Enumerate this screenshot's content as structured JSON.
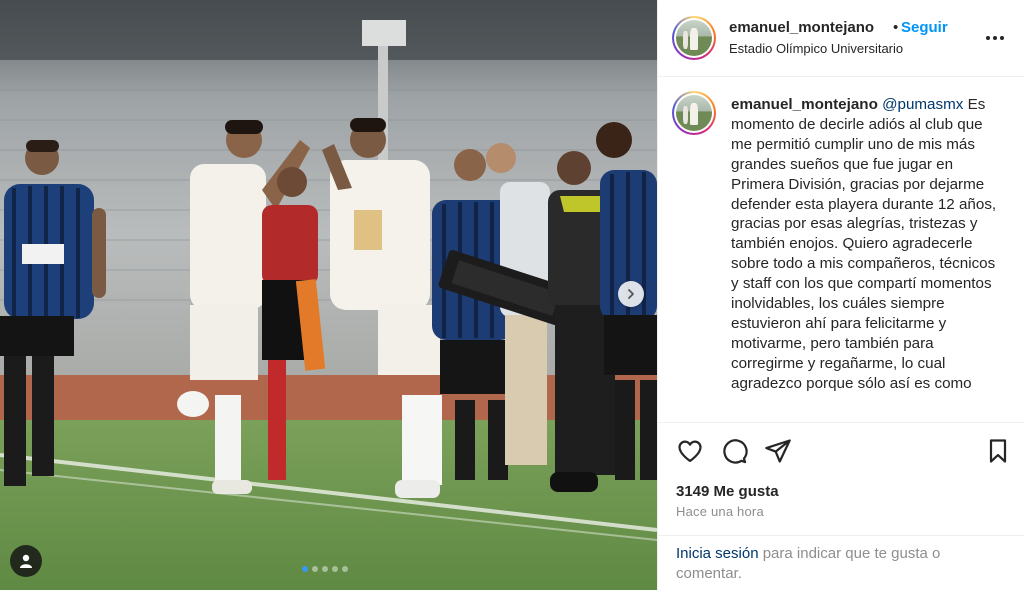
{
  "post": {
    "slide_count": 5,
    "active_slide": 1
  },
  "header": {
    "username": "emanuel_montejano",
    "separator": "•",
    "follow_label": "Seguir",
    "location": "Estadio Olímpico Universitario"
  },
  "caption": {
    "username": "emanuel_montejano",
    "mention": "@pumasmx",
    "text": "Es momento de decirle adiós al club que me permitió cumplir uno de mis más grandes sueños que fue jugar en Primera División, gracias por dejarme defender esta playera durante 12 años, gracias por esas alegrías, tristezas y también enojos. Quiero agradecerle sobre todo a mis compañeros, técnicos y staff con los que compartí momentos inolvidables, los cuáles siempre estuvieron ahí para felicitarme y motivarme, pero también para corregirme y regañarme, lo cual agradezco porque sólo así es como"
  },
  "stats": {
    "likes": "3149 Me gusta",
    "time_ago": "Hace una hora"
  },
  "login": {
    "link": "Inicia sesión",
    "rest": " para indicar que te gusta o comentar."
  },
  "icons": {
    "like": "heart-icon",
    "comment": "comment-icon",
    "share": "paper-plane-icon",
    "save": "bookmark-icon",
    "more": "more-options-icon",
    "next": "chevron-right-icon",
    "tags": "user-tag-icon"
  },
  "colors": {
    "follow": "#0095f6",
    "mention": "#00376b",
    "muted": "#8e8e8e",
    "active_dot": "#3897f0"
  }
}
